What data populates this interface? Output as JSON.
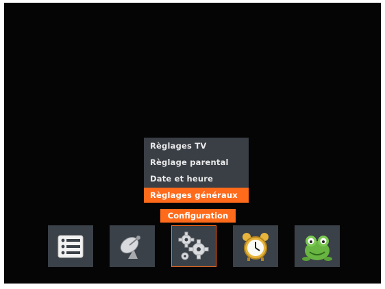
{
  "menu": {
    "items": [
      {
        "label": "Règlages TV"
      },
      {
        "label": "Règlage parental"
      },
      {
        "label": "Date et heure"
      },
      {
        "label": "Règlages généraux"
      }
    ],
    "selected_index": 3
  },
  "category_label": "Configuration",
  "icons": [
    {
      "name": "list-icon"
    },
    {
      "name": "satellite-dish-icon"
    },
    {
      "name": "gears-icon"
    },
    {
      "name": "alarm-clock-icon"
    },
    {
      "name": "frog-mascot-icon"
    }
  ],
  "active_icon_index": 2,
  "colors": {
    "accent": "#ff6b1a",
    "menu_bg": "#3a3f46",
    "screen_bg": "#050505"
  }
}
